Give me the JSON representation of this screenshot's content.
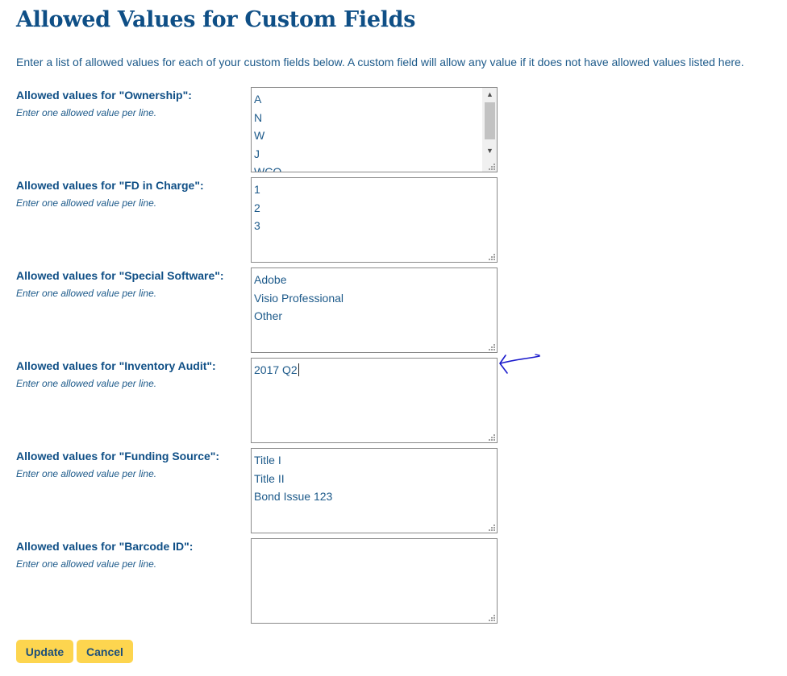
{
  "page": {
    "title": "Allowed Values for Custom Fields",
    "intro": "Enter a list of allowed values for each of your custom fields below.  A custom field will allow any value if it does not have allowed values listed here."
  },
  "fields": [
    {
      "label": "Allowed values for \"Ownership\":",
      "hint": "Enter one allowed value per line.",
      "values": [
        "A",
        "N",
        "W",
        "J",
        "WCO"
      ],
      "has_scrollbar": true
    },
    {
      "label": "Allowed values for \"FD in Charge\":",
      "hint": "Enter one allowed value per line.",
      "values": [
        "1",
        "2",
        "3"
      ]
    },
    {
      "label": "Allowed values for \"Special Software\":",
      "hint": "Enter one allowed value per line.",
      "values": [
        "Adobe",
        "Visio Professional",
        "Other"
      ]
    },
    {
      "label": "Allowed values for \"Inventory Audit\":",
      "hint": "Enter one allowed value per line.",
      "values": [
        "2017 Q2"
      ],
      "focused": true
    },
    {
      "label": "Allowed values for \"Funding Source\":",
      "hint": "Enter one allowed value per line.",
      "values": [
        "Title I",
        "Title II",
        "Bond Issue 123"
      ]
    },
    {
      "label": "Allowed values for \"Barcode ID\":",
      "hint": "Enter one allowed value per line.",
      "values": []
    }
  ],
  "buttons": {
    "update_label": "Update",
    "cancel_label": "Cancel"
  },
  "annotation": {
    "icon": "hand-drawn-arrow-icon",
    "color": "#1a1acc"
  },
  "colors": {
    "title": "#0f4f86",
    "text": "#1d5a8a",
    "button": "#fdd54f",
    "button_text": "#1d4f7a"
  }
}
